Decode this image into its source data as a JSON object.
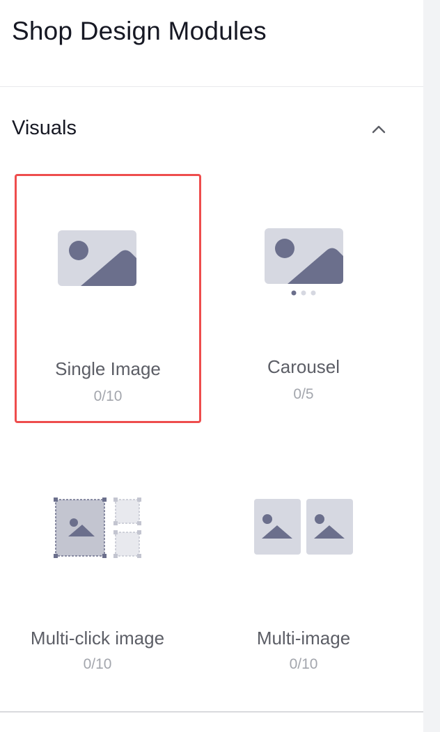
{
  "page": {
    "title": "Shop Design Modules"
  },
  "section": {
    "title": "Visuals",
    "collapse_icon": "chevron-up-icon"
  },
  "modules": [
    {
      "label": "Single Image",
      "count": "0/10",
      "icon": "single-image-icon",
      "selected": true
    },
    {
      "label": "Carousel",
      "count": "0/5",
      "icon": "carousel-icon",
      "selected": false
    },
    {
      "label": "Multi-click image",
      "count": "0/10",
      "icon": "multi-click-image-icon",
      "selected": false
    },
    {
      "label": "Multi-image",
      "count": "0/10",
      "icon": "multi-image-icon",
      "selected": false
    }
  ],
  "colors": {
    "selected_border": "#ee4d4d",
    "icon_bg": "#d6d8e1",
    "icon_fg": "#6b6f8c"
  }
}
